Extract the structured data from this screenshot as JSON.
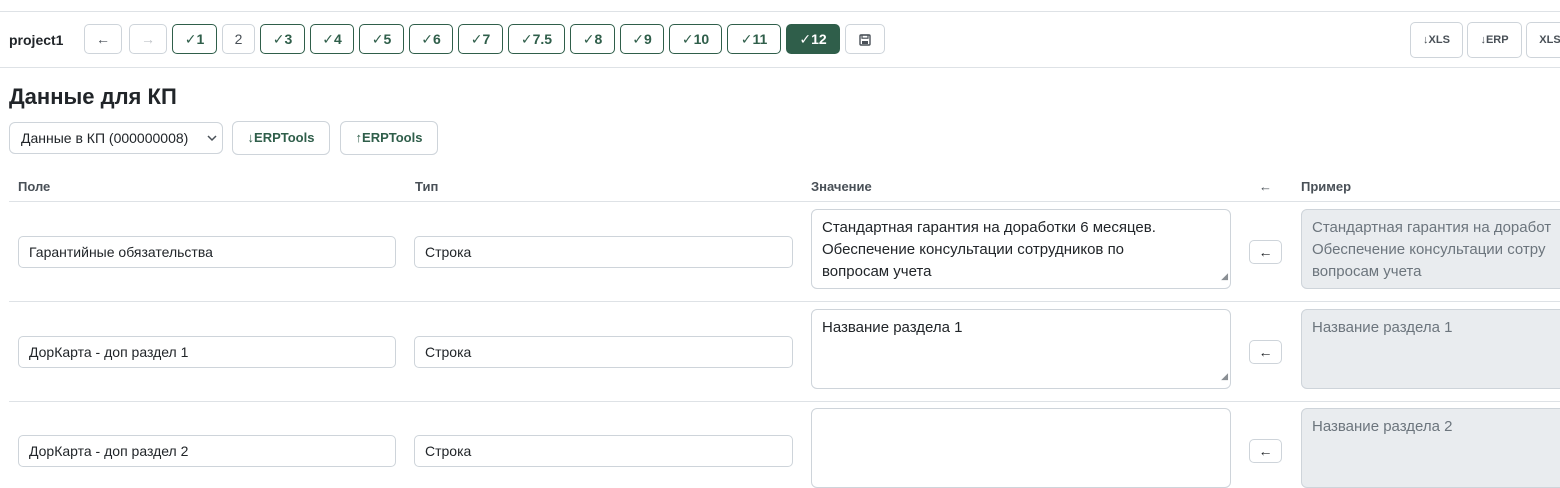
{
  "toolbar": {
    "project": "project1",
    "back": "←",
    "forward": "→",
    "steps": [
      "✓1",
      "2",
      "✓3",
      "✓4",
      "✓5",
      "✓6",
      "✓7",
      "✓7.5",
      "✓8",
      "✓9",
      "✓10",
      "✓11",
      "✓12"
    ],
    "active_step": "✓12",
    "save_icon": "floppy-disk-icon",
    "export_xls": "↓XLS",
    "export_erp": "↓ERP",
    "export_xls2": "XLS"
  },
  "page": {
    "title": "Данные для КП",
    "select_value": "Данные в КП (000000008)",
    "erp_download": "↓ERPTools",
    "erp_upload": "↑ERPTools"
  },
  "table": {
    "headers": {
      "field": "Поле",
      "type": "Тип",
      "value": "Значение",
      "copy": "←",
      "example": "Пример"
    },
    "copy_label": "←",
    "rows": [
      {
        "field": "Гарантийные обязательства",
        "type": "Строка",
        "value": [
          "Стандартная гарантия на доработки 6 месяцев.",
          "Обеспечение консультации сотрудников по",
          "вопросам учета"
        ],
        "example": [
          "Стандартная гарантия на доработ",
          "Обеспечение консультации сотру",
          "вопросам учета"
        ]
      },
      {
        "field": "ДорКарта - доп раздел 1",
        "type": "Строка",
        "value": [
          "Название раздела 1"
        ],
        "example": [
          "Название раздела 1"
        ]
      },
      {
        "field": "ДорКарта - доп раздел 2",
        "type": "Строка",
        "value": [],
        "example": [
          "Название раздела 2"
        ]
      }
    ]
  },
  "colors": {
    "accent": "#2f5e4a",
    "border": "#ced4da",
    "readonly_bg": "#e9ecef"
  }
}
